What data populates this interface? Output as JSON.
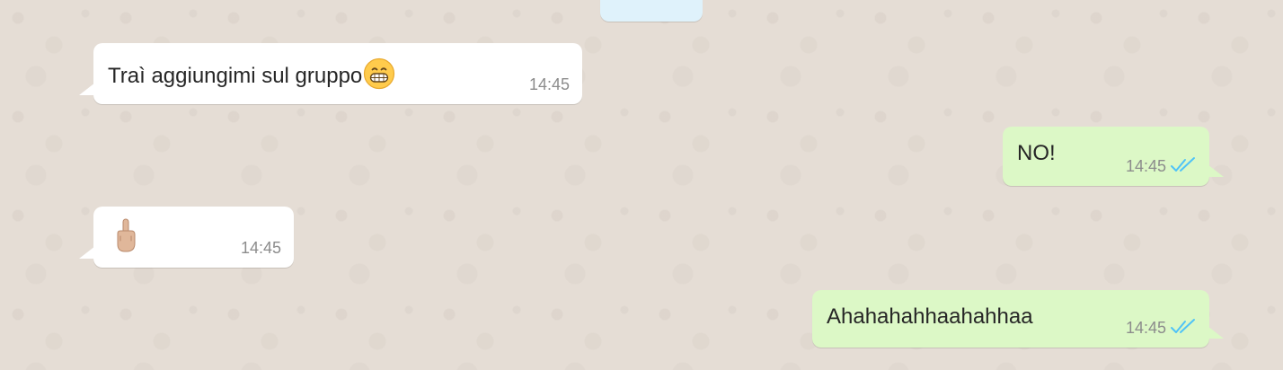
{
  "colors": {
    "background": "#e5ddd5",
    "incoming_bubble": "#ffffff",
    "outgoing_bubble": "#dcf8c6",
    "read_ticks": "#4fc3f7",
    "timestamp": "#8c8c8c"
  },
  "messages": [
    {
      "direction": "incoming",
      "text": "Traì aggiungimi sul gruppo",
      "emoji": "grinning-face-with-clenched-teeth",
      "time": "14:45"
    },
    {
      "direction": "outgoing",
      "text": "NO!",
      "time": "14:45",
      "status": "read"
    },
    {
      "direction": "incoming",
      "text": "",
      "emoji": "middle-finger",
      "time": "14:45"
    },
    {
      "direction": "outgoing",
      "text": "Ahahahahhaahahhaa",
      "time": "14:45",
      "status": "read"
    }
  ]
}
